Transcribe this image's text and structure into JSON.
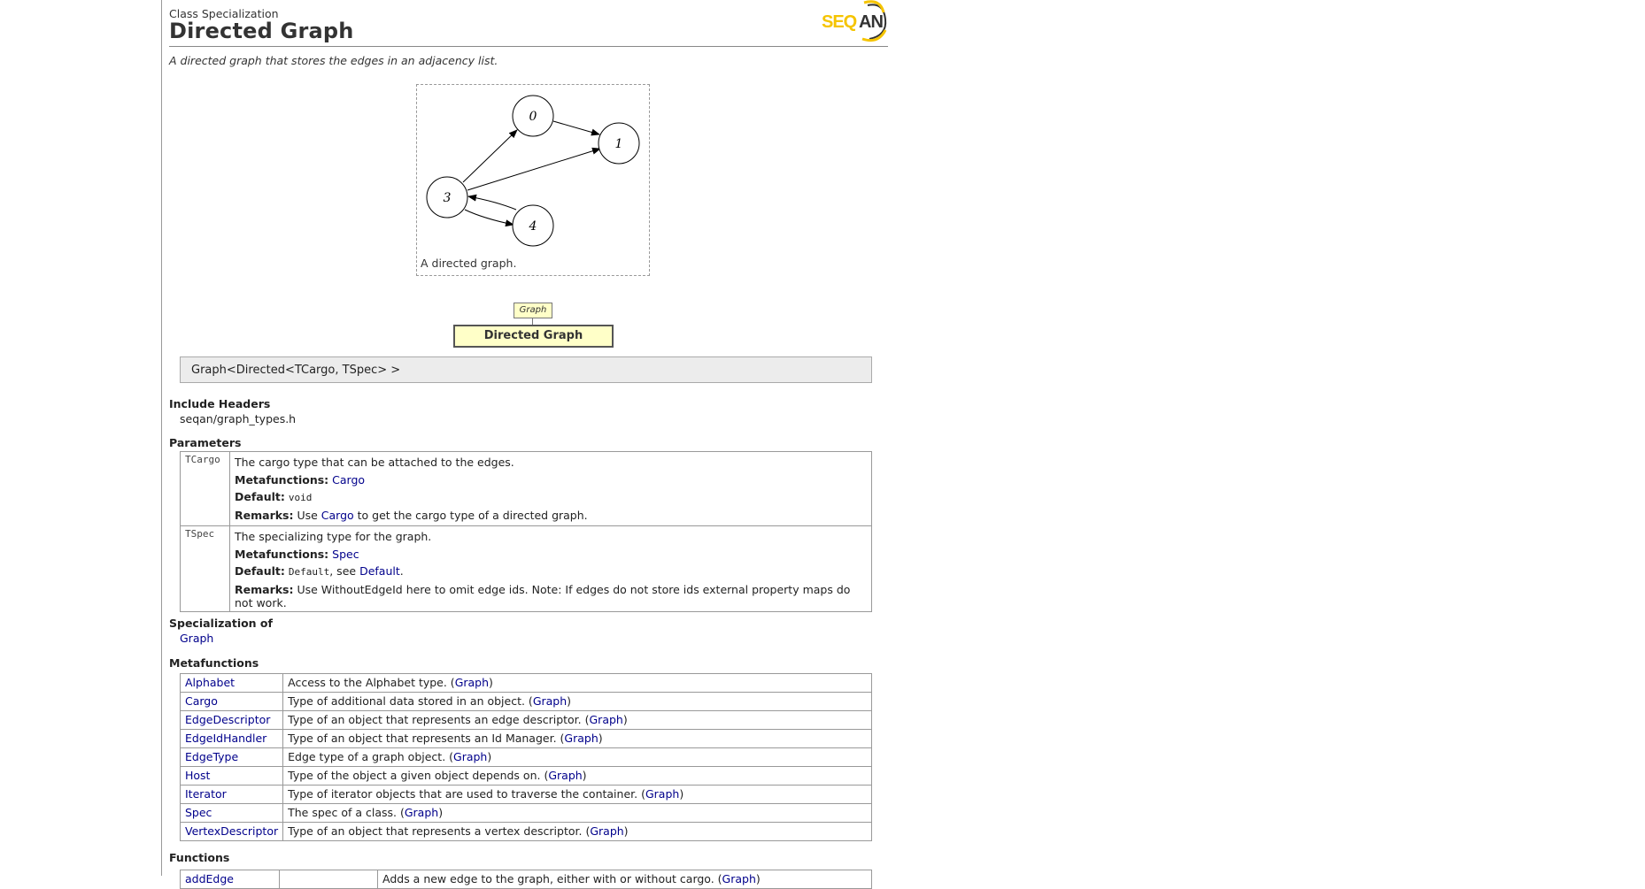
{
  "header": {
    "kind": "Class Specialization",
    "title": "Directed Graph",
    "logo_text": "SEQAN"
  },
  "description": "A directed graph that stores the edges in an adjacency list.",
  "figure": {
    "caption": "A directed graph.",
    "nodes": [
      "0",
      "1",
      "3",
      "4"
    ]
  },
  "inheritance": {
    "base": "Graph",
    "self": "Directed Graph"
  },
  "signature": "Graph<Directed<TCargo, TSpec> >",
  "include": {
    "heading": "Include Headers",
    "file": "seqan/graph_types.h"
  },
  "parameters": {
    "heading": "Parameters",
    "meta_label": "Metafunctions:",
    "default_label": "Default:",
    "remarks_label": "Remarks:",
    "items": [
      {
        "name": "TCargo",
        "desc": "The cargo type that can be attached to the edges.",
        "meta": "Cargo",
        "default": "void",
        "remarks_pre": "Use ",
        "remarks_link": "Cargo",
        "remarks_post": " to get the cargo type of a directed graph."
      },
      {
        "name": "TSpec",
        "desc": "The specializing type for the graph.",
        "meta": "Spec",
        "default": "Default",
        "default_see": ", see ",
        "default_link": "Default",
        "default_end": ".",
        "remarks_text": "Use WithoutEdgeId here to omit edge ids. Note: If edges do not store ids external property maps do not work."
      }
    ]
  },
  "specialization": {
    "heading": "Specialization of",
    "link": "Graph"
  },
  "metafunctions": {
    "heading": "Metafunctions",
    "rows": [
      {
        "name": "Alphabet",
        "desc": "Access to the Alphabet type. (",
        "ref": "Graph",
        "end": ")"
      },
      {
        "name": "Cargo",
        "desc": "Type of additional data stored in an object. (",
        "ref": "Graph",
        "end": ")"
      },
      {
        "name": "EdgeDescriptor",
        "desc": "Type of an object that represents an edge descriptor. (",
        "ref": "Graph",
        "end": ")"
      },
      {
        "name": "EdgeIdHandler",
        "desc": "Type of an object that represents an Id Manager. (",
        "ref": "Graph",
        "end": ")"
      },
      {
        "name": "EdgeType",
        "desc": "Edge type of a graph object. (",
        "ref": "Graph",
        "end": ")"
      },
      {
        "name": "Host",
        "desc": "Type of the object a given object depends on. (",
        "ref": "Graph",
        "end": ")"
      },
      {
        "name": "Iterator",
        "desc": "Type of iterator objects that are used to traverse the container. (",
        "ref": "Graph",
        "end": ")"
      },
      {
        "name": "Spec",
        "desc": "The spec of a class. (",
        "ref": "Graph",
        "end": ")"
      },
      {
        "name": "VertexDescriptor",
        "desc": "Type of an object that represents a vertex descriptor. (",
        "ref": "Graph",
        "end": ")"
      }
    ]
  },
  "functions": {
    "heading": "Functions",
    "rows": [
      {
        "name": "addEdge",
        "desc": "Adds a new edge to the graph, either with or without cargo. (",
        "ref": "Graph",
        "end": ")"
      }
    ]
  },
  "colors": {
    "link": "#00008b",
    "inheritance_fill": "#ffffc8",
    "signature_bg": "#ececec",
    "logo_yellow": "#f5c400"
  }
}
